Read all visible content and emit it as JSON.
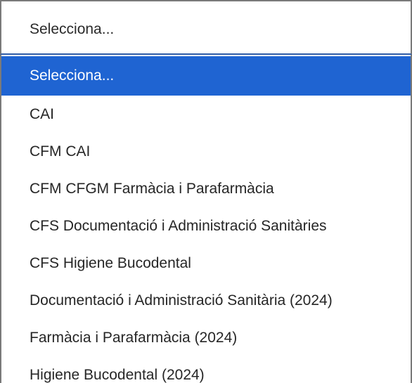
{
  "select": {
    "current_value": "Selecciona...",
    "options": [
      {
        "label": "Selecciona...",
        "selected": true
      },
      {
        "label": "CAI",
        "selected": false
      },
      {
        "label": "CFM CAI",
        "selected": false
      },
      {
        "label": "CFM CFGM Farmàcia i Parafarmàcia",
        "selected": false
      },
      {
        "label": "CFS Documentació i Administració Sanitàries",
        "selected": false
      },
      {
        "label": "CFS Higiene Bucodental",
        "selected": false
      },
      {
        "label": "Documentació i Administració Sanitària (2024)",
        "selected": false
      },
      {
        "label": "Farmàcia i Parafarmàcia (2024)",
        "selected": false
      },
      {
        "label": "Higiene Bucodental (2024)",
        "selected": false
      }
    ]
  },
  "colors": {
    "selected_background": "#1f64d2",
    "selected_text": "#ffffff",
    "option_text": "#262626",
    "border": "#7a7a7a",
    "focus_border": "#2f5ca6"
  }
}
